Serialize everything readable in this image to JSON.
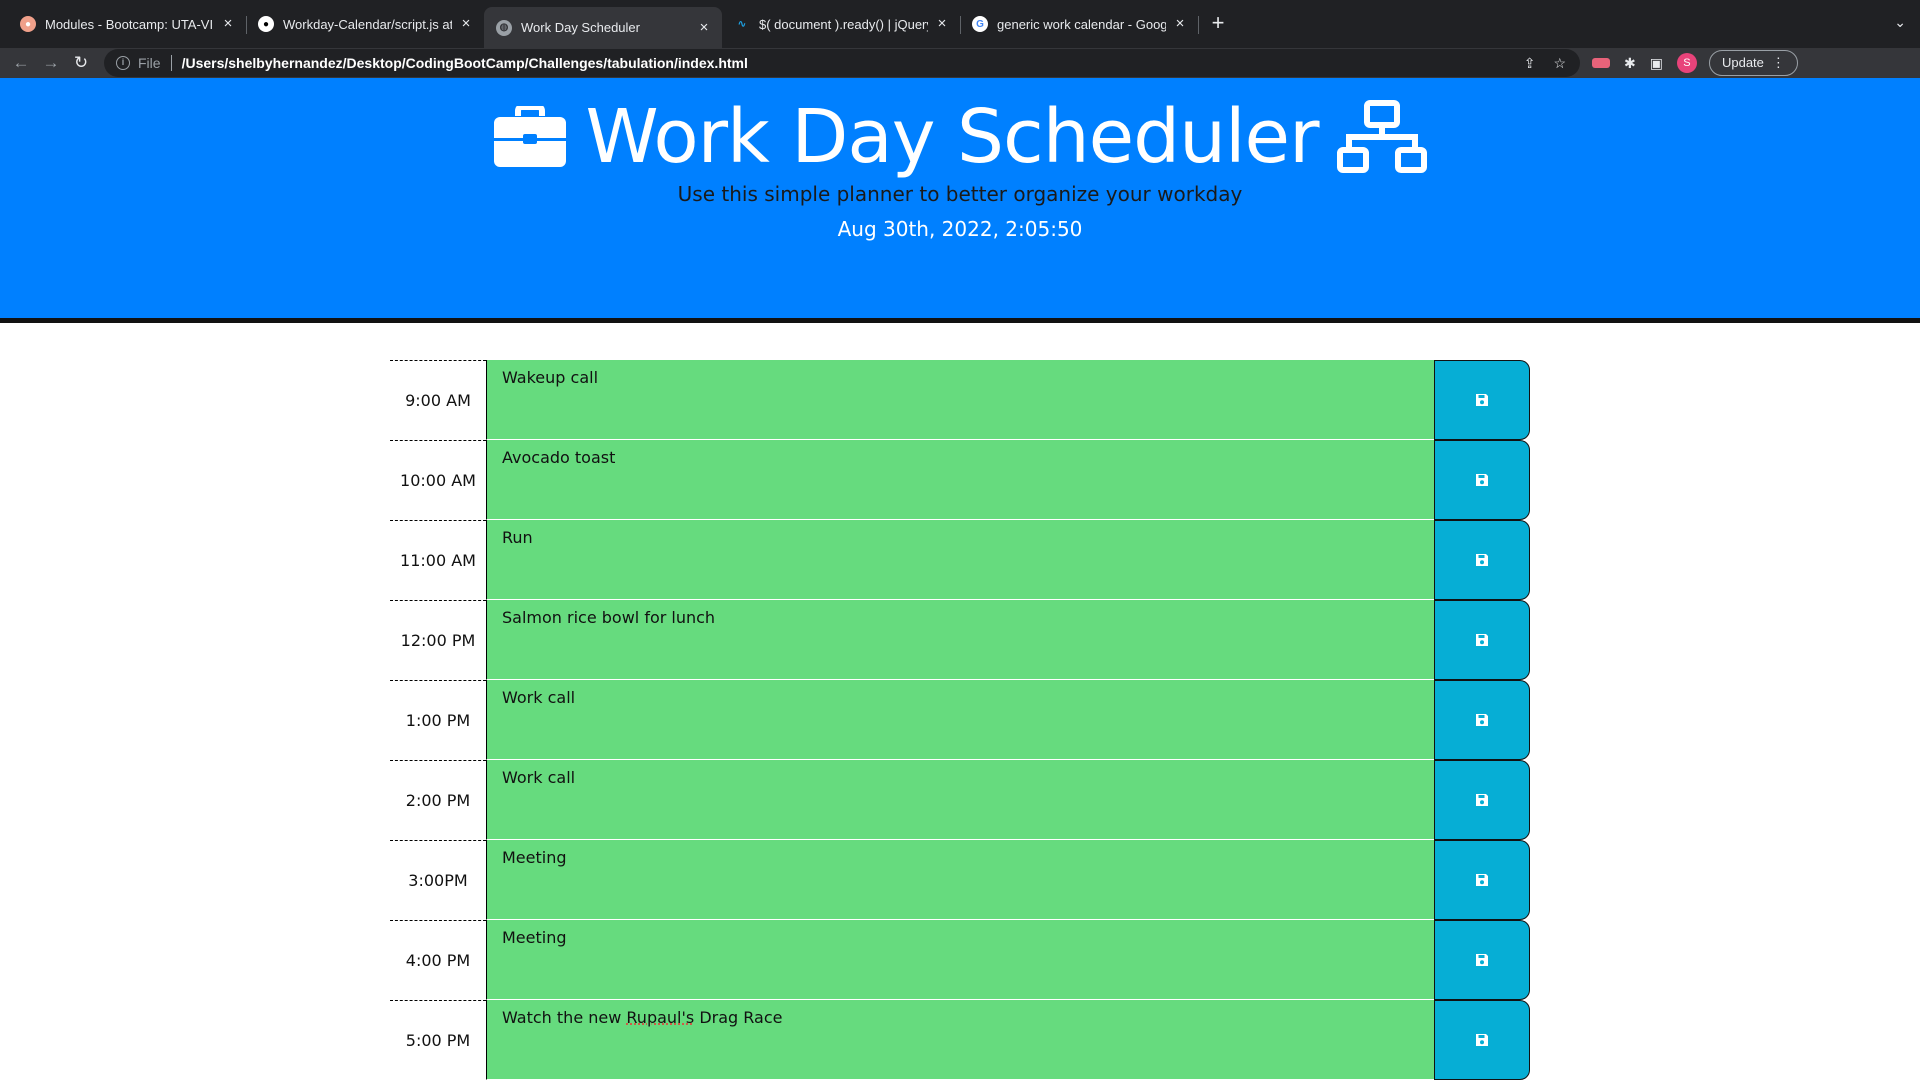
{
  "browser": {
    "tabs": [
      {
        "title": "Modules - Bootcamp: UTA-VIR",
        "favicon": "canvas-icon",
        "active": false
      },
      {
        "title": "Workday-Calendar/script.js at",
        "favicon": "github-icon",
        "active": false
      },
      {
        "title": "Work Day Scheduler",
        "favicon": "globe-icon",
        "active": true
      },
      {
        "title": "$( document ).ready() | jQuery",
        "favicon": "jquery-icon",
        "active": false
      },
      {
        "title": "generic work calendar - Google",
        "favicon": "google-icon",
        "active": false
      }
    ],
    "scheme_label": "File",
    "url": "/Users/shelbyhernandez/Desktop/CodingBootCamp/Challenges/tabulation/index.html",
    "profile_initial": "S",
    "update_label": "Update"
  },
  "header": {
    "title": "Work Day Scheduler",
    "subtitle": "Use this simple planner to better organize your workday",
    "current_day": "Aug 30th, 2022, 2:05:50",
    "color": "#0080ff"
  },
  "schedule": {
    "rows": [
      {
        "hour": "9:00 AM",
        "text": "Wakeup call"
      },
      {
        "hour": "10:00 AM",
        "text": "Avocado toast"
      },
      {
        "hour": "11:00 AM",
        "text": "Run"
      },
      {
        "hour": "12:00 PM",
        "text": "Salmon rice bowl for lunch"
      },
      {
        "hour": "1:00 PM",
        "text": "Work call"
      },
      {
        "hour": "2:00 PM",
        "text": "Work call"
      },
      {
        "hour": "3:00PM",
        "text": "Meeting"
      },
      {
        "hour": "4:00 PM",
        "text": "Meeting"
      },
      {
        "hour": "5:00 PM",
        "text": "Watch the new Rupaul's Drag Race"
      }
    ],
    "future_color": "#66db7e",
    "save_color": "#06aed5"
  }
}
